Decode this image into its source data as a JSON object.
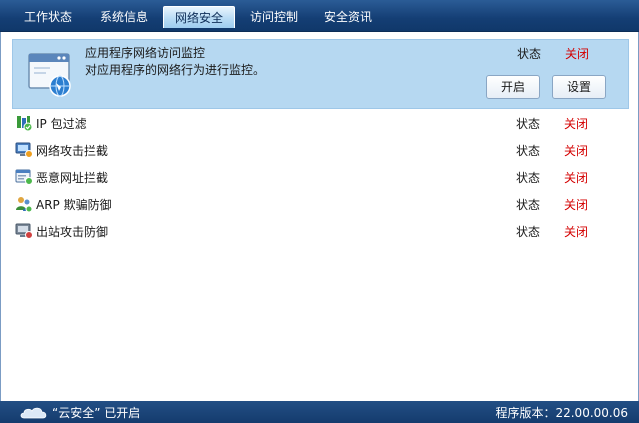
{
  "tabs": [
    {
      "label": "工作状态",
      "active": false
    },
    {
      "label": "系统信息",
      "active": false
    },
    {
      "label": "网络安全",
      "active": true
    },
    {
      "label": "访问控制",
      "active": false
    },
    {
      "label": "安全资讯",
      "active": false
    }
  ],
  "featured": {
    "icon": "app-window-globe-icon",
    "title": "应用程序网络访问监控",
    "description": "对应用程序的网络行为进行监控。",
    "status_label": "状态",
    "status_value": "关闭",
    "open_label": "开启",
    "settings_label": "设置"
  },
  "features": [
    {
      "icon": "ip-filter-icon",
      "label": "IP 包过滤",
      "status_label": "状态",
      "status_value": "关闭"
    },
    {
      "icon": "network-attack-block-icon",
      "label": "网络攻击拦截",
      "status_label": "状态",
      "status_value": "关闭"
    },
    {
      "icon": "malicious-url-block-icon",
      "label": "恶意网址拦截",
      "status_label": "状态",
      "status_value": "关闭"
    },
    {
      "icon": "arp-defense-icon",
      "label": "ARP 欺骗防御",
      "status_label": "状态",
      "status_value": "关闭"
    },
    {
      "icon": "outbound-attack-defense-icon",
      "label": "出站攻击防御",
      "status_label": "状态",
      "status_value": "关闭"
    }
  ],
  "statusbar": {
    "cloud_icon": "cloud-icon",
    "cloud_text": "“云安全” 已开启",
    "version": "程序版本：22.00.00.06"
  },
  "colors": {
    "tabbar": "#143e74",
    "active_tab": "#b9dcf5",
    "featured_bg": "#b6d8f1",
    "status_off": "#d40000",
    "statusbar": "#1a4479"
  }
}
